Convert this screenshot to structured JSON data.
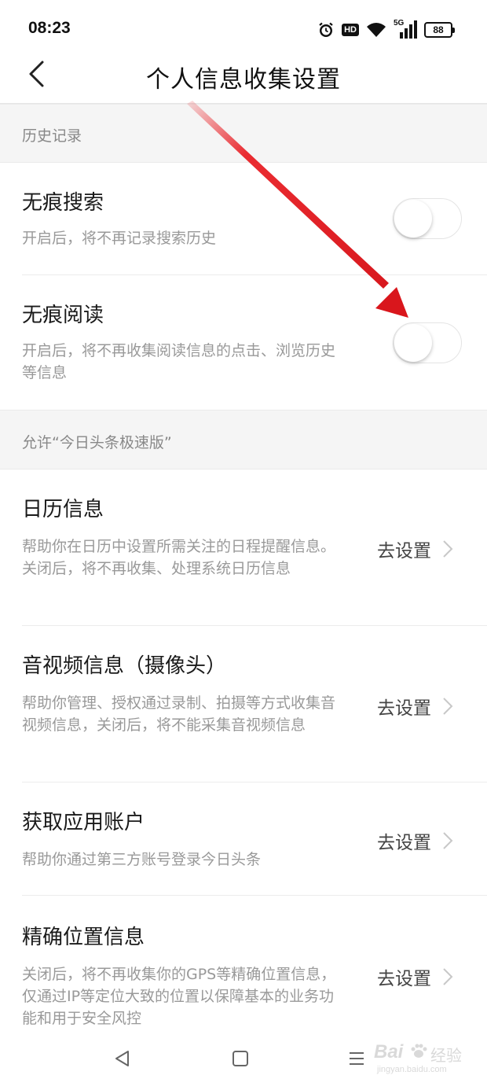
{
  "status_bar": {
    "time": "08:23",
    "icons": [
      "alarm-icon",
      "hd-icon",
      "wifi-icon",
      "signal-5g-icon",
      "battery-icon"
    ],
    "hd_label": "HD",
    "network_label": "5G",
    "battery_level": "88"
  },
  "header": {
    "title": "个人信息收集设置",
    "back_icon": "chevron-left-icon"
  },
  "section_history": {
    "label": "历史记录"
  },
  "incognito_search": {
    "title": "无痕搜索",
    "description": "开启后，将不再记录搜索历史",
    "enabled": false
  },
  "incognito_reading": {
    "title": "无痕阅读",
    "description": "开启后，将不再收集阅读信息的点击、浏览历史等信息",
    "enabled": false
  },
  "section_allow": {
    "label": "允许“今日头条极速版”"
  },
  "permissions": [
    {
      "title": "日历信息",
      "description": "帮助你在日历中设置所需关注的日程提醒信息。关闭后，将不再收集、处理系统日历信息",
      "action": "去设置"
    },
    {
      "title": "音视频信息（摄像头）",
      "description": "帮助你管理、授权通过录制、拍摄等方式收集音视频信息，关闭后，将不能采集音视频信息",
      "action": "去设置"
    },
    {
      "title": "获取应用账户",
      "description": "帮助你通过第三方账号登录今日头条",
      "action": "去设置"
    },
    {
      "title": "精确位置信息",
      "description": "关闭后，将不再收集你的GPS等精确位置信息，仅通过IP等定位大致的位置以保障基本的业务功能和用于安全风控",
      "action": "去设置"
    }
  ],
  "nav_bar": {
    "buttons": [
      "back-triangle-icon",
      "home-square-icon",
      "menu-lines-icon"
    ]
  },
  "watermark": {
    "brand": "Bai",
    "brand_suffix": "经验",
    "url": "jingyan.baidu.com"
  },
  "colors": {
    "annotation_arrow": "#e8151b",
    "section_bg": "#f5f5f5",
    "secondary_text": "#999999"
  }
}
